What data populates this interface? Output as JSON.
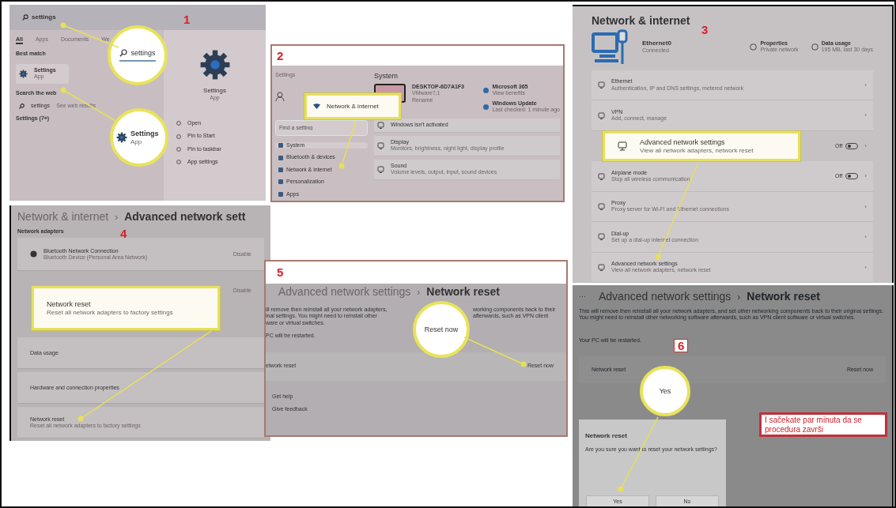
{
  "step1": {
    "step": "1",
    "search_text": "settings",
    "tabs": [
      {
        "label": "All",
        "selected": true
      },
      {
        "label": "Apps",
        "selected": false
      },
      {
        "label": "Documents",
        "selected": false
      },
      {
        "label": "We",
        "selected": false
      }
    ],
    "best_match_heading": "Best match",
    "best_match": {
      "title": "Settings",
      "subtitle": "App"
    },
    "web_heading": "Search the web",
    "web_result": {
      "query": "settings",
      "hint": "See web results"
    },
    "more": "Settings (7+)",
    "preview": {
      "title": "Settings",
      "subtitle": "App",
      "actions": [
        "Open",
        "Pin to Start",
        "Pin to taskbar",
        "App settings"
      ]
    },
    "search_callout": "settings",
    "app_callout": {
      "title": "Settings",
      "subtitle": "App"
    }
  },
  "step2": {
    "step": "2",
    "app_title": "Settings",
    "page_title": "System",
    "search_placeholder": "Find a setting",
    "nav": [
      {
        "label": "System",
        "selected": true
      },
      {
        "label": "Bluetooth & devices",
        "selected": false
      },
      {
        "label": "Network & internet",
        "selected": false
      },
      {
        "label": "Personalization",
        "selected": false
      },
      {
        "label": "Apps",
        "selected": false
      }
    ],
    "device": {
      "name": "DESKTOP-6D7A1F3",
      "model": "VMware7,1",
      "rename": "Rename"
    },
    "tiles": [
      {
        "title": "Microsoft 365",
        "subtitle": "View benefits"
      },
      {
        "title": "Windows Update",
        "subtitle": "Last checked: 1 minute ago"
      }
    ],
    "rows": [
      {
        "title": "Windows isn't activated"
      },
      {
        "title": "Display",
        "subtitle": "Monitors, brightness, night light, display profile"
      },
      {
        "title": "Sound",
        "subtitle": "Volume levels, output, input, sound devices"
      }
    ],
    "callout": "Network & internet"
  },
  "step3": {
    "step": "3",
    "title": "Network & internet",
    "connection": {
      "name": "Ethernet0",
      "status": "Connected"
    },
    "shortcuts": [
      {
        "title": "Properties",
        "subtitle": "Private network"
      },
      {
        "title": "Data usage",
        "subtitle": "195 MB, last 30 days"
      }
    ],
    "rows": [
      {
        "kind": "link",
        "title": "Ethernet",
        "subtitle": "Authentication, IP and DNS settings, metered network",
        "arrow": "›"
      },
      {
        "kind": "link",
        "title": "VPN",
        "subtitle": "Add, connect, manage",
        "arrow": "›"
      },
      {
        "kind": "toggle",
        "state_label": "Off",
        "on": false,
        "arrow": "›"
      },
      {
        "kind": "toggle",
        "title": "Airplane mode",
        "subtitle": "Stop all wireless communication",
        "state_label": "Off",
        "on": false,
        "arrow": "›"
      },
      {
        "kind": "link",
        "title": "Proxy",
        "subtitle": "Proxy server for Wi-Fi and Ethernet connections",
        "arrow": "›"
      },
      {
        "kind": "link",
        "title": "Dial-up",
        "subtitle": "Set up a dial-up internet connection",
        "arrow": "›"
      },
      {
        "kind": "link",
        "title": "Advanced network settings",
        "subtitle": "View all network adapters, network reset",
        "arrow": "›"
      }
    ],
    "callout": {
      "title": "Advanced network settings",
      "subtitle": "View all network adapters, network reset"
    }
  },
  "step4": {
    "step": "4",
    "breadcrumb": "Network & internet",
    "separator": "›",
    "title": "Advanced network sett",
    "adapters_heading": "Network adapters",
    "adapters": [
      {
        "title": "Bluetooth Network Connection",
        "subtitle": "Bluetooth Device (Personal Area Network)",
        "action": "Disable"
      },
      {
        "action": "Disable"
      }
    ],
    "rows": [
      {
        "title": "Data usage"
      },
      {
        "title": "Hardware and connection properties"
      },
      {
        "title": "Network reset",
        "subtitle": "Reset all network adapters to factory settings"
      }
    ],
    "callout": {
      "title": "Network reset",
      "subtitle": "Reset all network adapters to factory settings"
    }
  },
  "step5": {
    "step": "5",
    "breadcrumb": "Advanced network settings",
    "separator": "›",
    "title": "Network reset",
    "lines": [
      [
        "ill remove then reinstall all your network adapters,",
        "working components back to their"
      ],
      [
        "inal settings. You might need to reinstall other",
        "afterwards, such as VPN client"
      ],
      [
        "ware or virtual switches."
      ]
    ],
    "restart": "PC will be restarted.",
    "row": {
      "title": "etwork reset",
      "action": "Reset now"
    },
    "links": [
      "Get help",
      "Give feedback"
    ],
    "callout": "Reset now"
  },
  "step6": {
    "step": "6",
    "more": "···",
    "breadcrumb": "Advanced network settings",
    "separator": "›",
    "title": "Network reset",
    "paragraph": "This will remove then reinstall all your network adapters, and set other networking components back to their original settings. You might need to reinstall other networking software afterwards, such as VPN client software or virtual switches.",
    "restart": "Your PC will be restarted.",
    "row": {
      "title": "Network reset",
      "action": "Reset now"
    },
    "dialog": {
      "title": "Network reset",
      "message": "Are you sure you want to reset your network settings?",
      "buttons": [
        "Yes",
        "No"
      ]
    },
    "callout": "Yes",
    "note": "I sačekate par minuta da se procedura završi"
  }
}
